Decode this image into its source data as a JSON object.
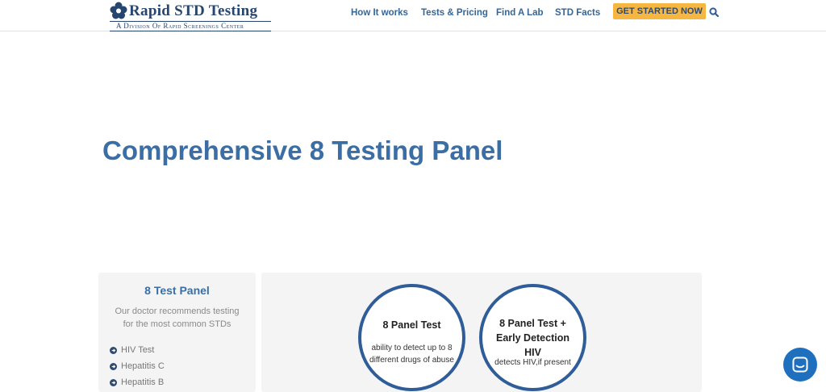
{
  "brand": {
    "name": "Rapid STD Testing",
    "tagline": "A Division Of Rapid Screenings Center"
  },
  "nav": {
    "items": [
      "How It works",
      "Tests & Pricing",
      "Find A Lab",
      "STD Facts"
    ],
    "cta_label": "GET STARTED NOW"
  },
  "page": {
    "title": "Comprehensive 8 Testing Panel"
  },
  "sidebar": {
    "title": "8 Test Panel",
    "description": "Our doctor recommends testing for the most common STDs",
    "items": [
      "HIV Test",
      "Hepatitis C",
      "Hepatitis B"
    ]
  },
  "panels": [
    {
      "title": "8 Panel Test",
      "description": "ability to detect up to 8 different drugs of abuse"
    },
    {
      "title": "8 Panel Test + Early Detection HIV",
      "description": "detects HIV,if present"
    }
  ],
  "colors": {
    "brand_navy": "#27466f",
    "link_blue": "#336699",
    "title_blue": "#3a6ea5",
    "cta_orange": "#f6b642",
    "circle_border": "#2f5d99",
    "chat_blue": "#1f6fbf"
  }
}
